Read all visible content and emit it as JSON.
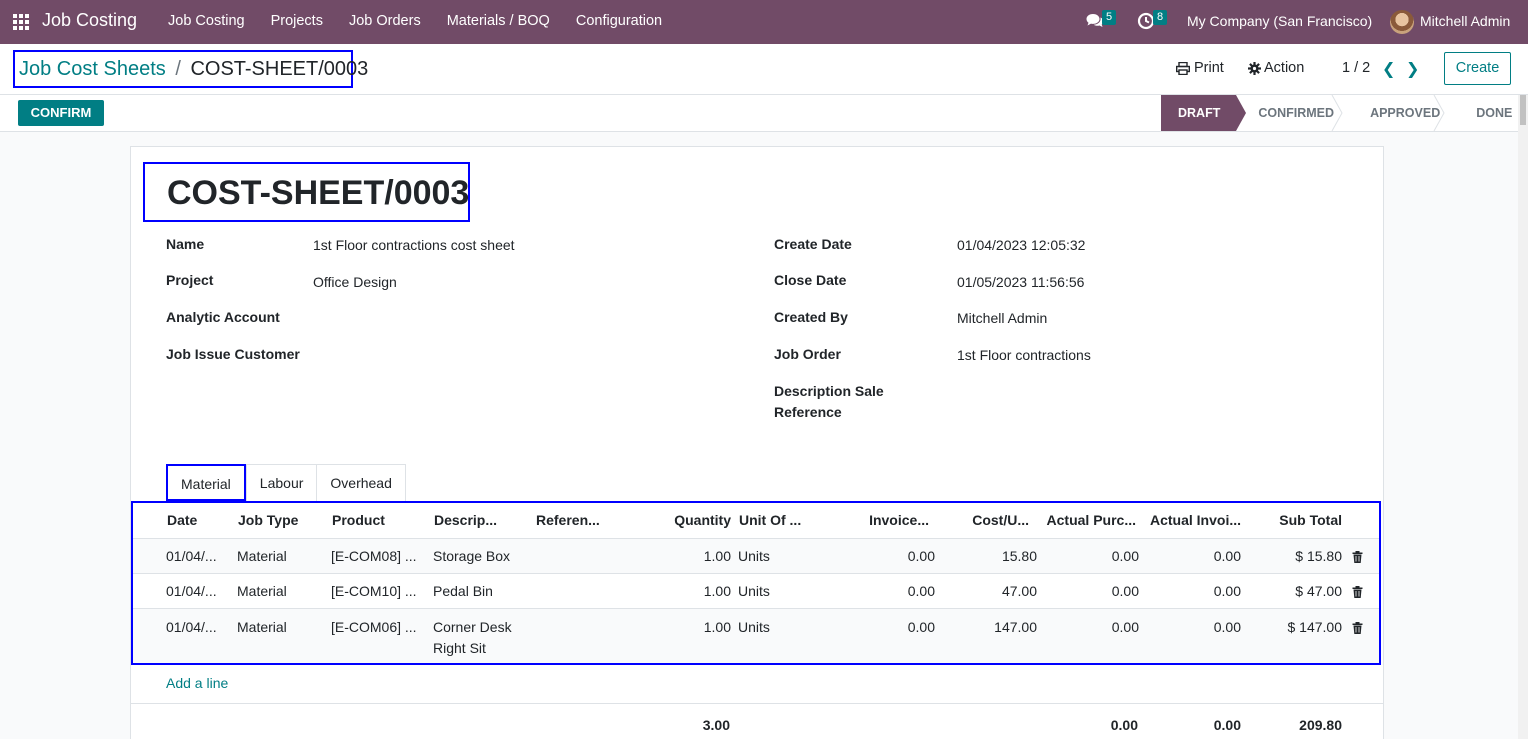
{
  "navbar": {
    "brand": "Job Costing",
    "menu": [
      "Job Costing",
      "Projects",
      "Job Orders",
      "Materials / BOQ",
      "Configuration"
    ],
    "messages_count": "5",
    "activities_count": "8",
    "company": "My Company (San Francisco)",
    "user": "Mitchell Admin"
  },
  "control_panel": {
    "breadcrumb_parent": "Job Cost Sheets",
    "breadcrumb_separator": "/",
    "breadcrumb_current": "COST-SHEET/0003",
    "print_label": "Print",
    "action_label": "Action",
    "pager": "1 / 2",
    "create_label": "Create"
  },
  "statusbar": {
    "confirm_label": "CONFIRM",
    "stages": [
      "DRAFT",
      "CONFIRMED",
      "APPROVED",
      "DONE"
    ],
    "active_stage": "DRAFT"
  },
  "record": {
    "title": "COST-SHEET/0003",
    "left_fields": [
      {
        "label": "Name",
        "value": "1st Floor contractions cost sheet"
      },
      {
        "label": "Project",
        "value": "Office Design"
      },
      {
        "label": "Analytic Account",
        "value": ""
      },
      {
        "label": "Job Issue Customer",
        "value": ""
      }
    ],
    "right_fields": [
      {
        "label": "Create Date",
        "value": "01/04/2023 12:05:32"
      },
      {
        "label": "Close Date",
        "value": "01/05/2023 11:56:56"
      },
      {
        "label": "Created By",
        "value": "Mitchell Admin"
      },
      {
        "label": "Job Order",
        "value": "1st Floor contractions"
      },
      {
        "label": "Description Sale",
        "label2": "Reference",
        "value": ""
      }
    ]
  },
  "tabs": [
    "Material",
    "Labour",
    "Overhead"
  ],
  "active_tab": "Material",
  "table": {
    "headers": [
      "Date",
      "Job Type",
      "Product",
      "Descrip...",
      "Referen...",
      "Quantity",
      "Unit Of ...",
      "Invoice...",
      "Cost/U...",
      "Actual Purc...",
      "Actual Invoi...",
      "Sub Total"
    ],
    "rows": [
      {
        "date": "01/04/...",
        "job_type": "Material",
        "product": "[E-COM08] ...",
        "description": "Storage Box",
        "description2": "",
        "reference": "",
        "quantity": "1.00",
        "uom": "Units",
        "invoice": "0.00",
        "cost_unit": "15.80",
        "actual_purchase": "0.00",
        "actual_invoice": "0.00",
        "subtotal": "$ 15.80"
      },
      {
        "date": "01/04/...",
        "job_type": "Material",
        "product": "[E-COM10] ...",
        "description": "Pedal Bin",
        "description2": "",
        "reference": "",
        "quantity": "1.00",
        "uom": "Units",
        "invoice": "0.00",
        "cost_unit": "47.00",
        "actual_purchase": "0.00",
        "actual_invoice": "0.00",
        "subtotal": "$ 47.00"
      },
      {
        "date": "01/04/...",
        "job_type": "Material",
        "product": "[E-COM06] ...",
        "description": "Corner Desk",
        "description2": "Right Sit",
        "reference": "",
        "quantity": "1.00",
        "uom": "Units",
        "invoice": "0.00",
        "cost_unit": "147.00",
        "actual_purchase": "0.00",
        "actual_invoice": "0.00",
        "subtotal": "$ 147.00"
      }
    ],
    "add_line": "Add a line",
    "totals": {
      "quantity": "3.00",
      "actual_purchase": "0.00",
      "actual_invoice": "0.00",
      "subtotal": "209.80"
    }
  },
  "colors": {
    "brand": "#714b67",
    "accent": "#017e84",
    "highlight_box": "#0000ff"
  },
  "icons": [
    "apps-grid-icon",
    "chat-icon",
    "clock-icon",
    "print-icon",
    "gear-icon",
    "chevron-left-icon",
    "chevron-right-icon",
    "trash-icon"
  ]
}
